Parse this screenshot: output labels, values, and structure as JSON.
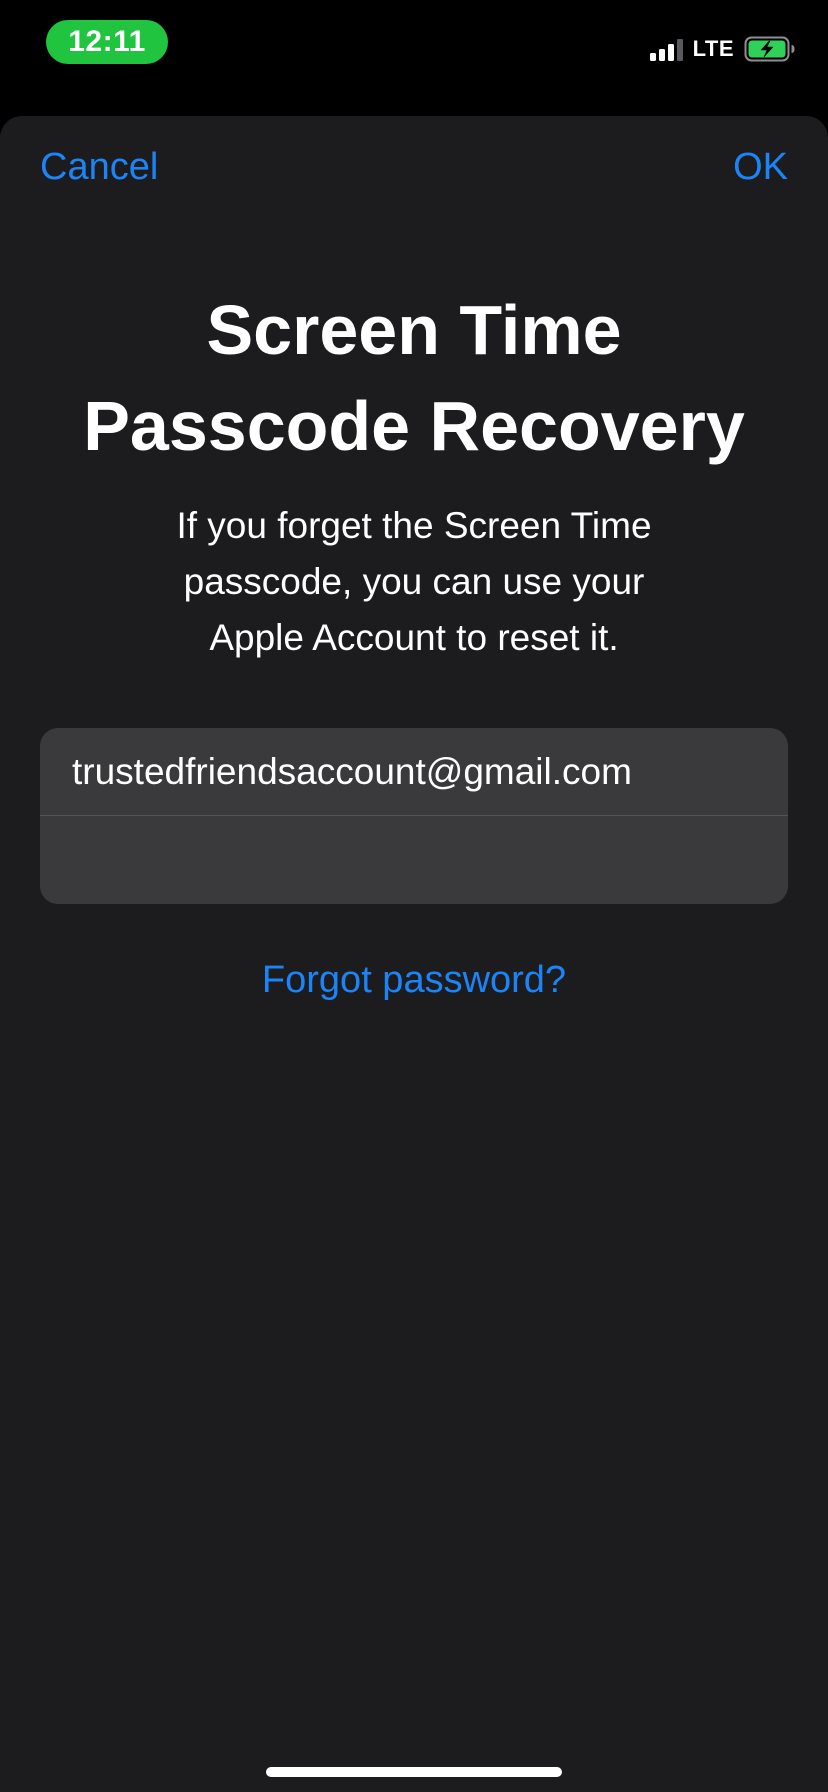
{
  "status_bar": {
    "time": "12:11",
    "network": "LTE",
    "signal_bars_active": 3,
    "battery_charging": true,
    "time_pill_color": "#20c43f",
    "battery_color": "#30d158"
  },
  "sheet": {
    "cancel_label": "Cancel",
    "ok_label": "OK",
    "title_line1": "Screen Time",
    "title_line2": "Passcode Recovery",
    "subtitle_line1": "If you forget the Screen Time",
    "subtitle_line2": "passcode, you can use your",
    "subtitle_line3": "Apple Account to reset it.",
    "email_value": "trustedfriendsaccount@gmail.com",
    "password_value": "",
    "forgot_label": "Forgot password?"
  },
  "colors": {
    "accent": "#1b84f7",
    "sheet_background": "#1c1c1e",
    "field_background": "#3a3a3c"
  }
}
